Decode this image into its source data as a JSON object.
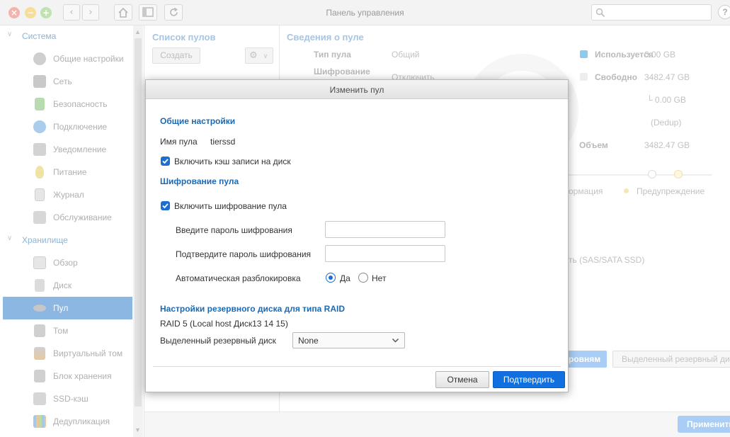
{
  "window": {
    "title": "Панель управления",
    "help": "?"
  },
  "sidebar": {
    "sections": [
      {
        "label": "Система",
        "items": [
          "Общие настройки",
          "Сеть",
          "Безопасность",
          "Подключение",
          "Уведомление",
          "Питание",
          "Журнал",
          "Обслуживание"
        ]
      },
      {
        "label": "Хранилище",
        "items": [
          "Обзор",
          "Диск",
          "Пул",
          "Том",
          "Виртуальный том",
          "Блок хранения",
          "SSD-кэш",
          "Дедупликация"
        ]
      }
    ],
    "active_item": "Пул"
  },
  "pool_list": {
    "title": "Список пулов",
    "create_label": "Создать"
  },
  "pool_details": {
    "title": "Сведения о пуле",
    "type_label": "Тип пула",
    "type_value": "Общий",
    "encryption_label": "Шифрование",
    "encryption_value": "Отключить",
    "used_label": "Используется",
    "used_value": "0.00 GB",
    "free_label": "Свободно",
    "free_value": "3482.47 GB",
    "sub_value": "└ 0.00 GB",
    "dedup_label": "(Dedup)",
    "volume_label": "Объем",
    "volume_value": "3482.47 GB",
    "legend_info": "ормация",
    "legend_warning": "Предупреждение",
    "disk_type": "ть (SAS/SATA SSD)",
    "levels_button": "ровням",
    "spare_button": "Выделенный резервный ди",
    "apply_label": "Применить",
    "colors": {
      "used": "#8ccbf0",
      "free": "#eeeeee"
    }
  },
  "dialog": {
    "title": "Изменить пул",
    "general": {
      "heading": "Общие настройки",
      "pool_name_label": "Имя пула",
      "pool_name_value": "tierssd",
      "write_cache_label": "Включить кэш записи на диск",
      "write_cache_checked": true
    },
    "encryption": {
      "heading": "Шифрование пула",
      "enable_label": "Включить шифрование пула",
      "enable_checked": true,
      "password_label": "Введите пароль шифрования",
      "password_value": "",
      "confirm_label": "Подтвердите пароль шифрования",
      "confirm_value": "",
      "auto_unlock_label": "Автоматическая разблокировка",
      "yes_label": "Да",
      "no_label": "Нет",
      "auto_unlock_selected": "Да"
    },
    "spare": {
      "heading": "Настройки резервного диска для типа RAID",
      "raid_info": "RAID 5 (Local host Диск13 14 15)",
      "spare_label": "Выделенный резервный диск",
      "spare_value": "None"
    },
    "buttons": {
      "cancel": "Отмена",
      "confirm": "Подтвердить"
    },
    "accent_color": "#1c6fd0"
  }
}
